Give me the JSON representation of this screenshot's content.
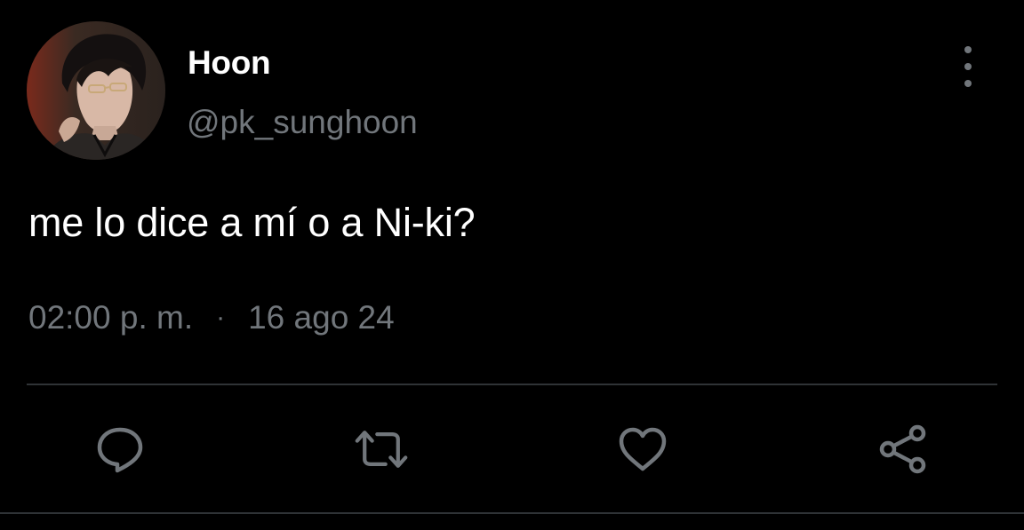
{
  "user": {
    "display_name": "Hoon",
    "handle": "@pk_sunghoon"
  },
  "tweet": {
    "text": "me lo dice a mí o a Ni-ki?",
    "time": "02:00 p. m.",
    "separator": "·",
    "date": "16 ago 24"
  },
  "actions": [
    {
      "name": "reply",
      "icon": "speech-bubble-icon"
    },
    {
      "name": "retweet",
      "icon": "retweet-arrows-icon"
    },
    {
      "name": "like",
      "icon": "heart-icon"
    },
    {
      "name": "share",
      "icon": "share-nodes-icon"
    }
  ],
  "colors": {
    "background": "#000000",
    "primary_text": "#ffffff",
    "secondary_text": "#71767b",
    "divider": "#2f3336",
    "icon": "#71767b"
  }
}
